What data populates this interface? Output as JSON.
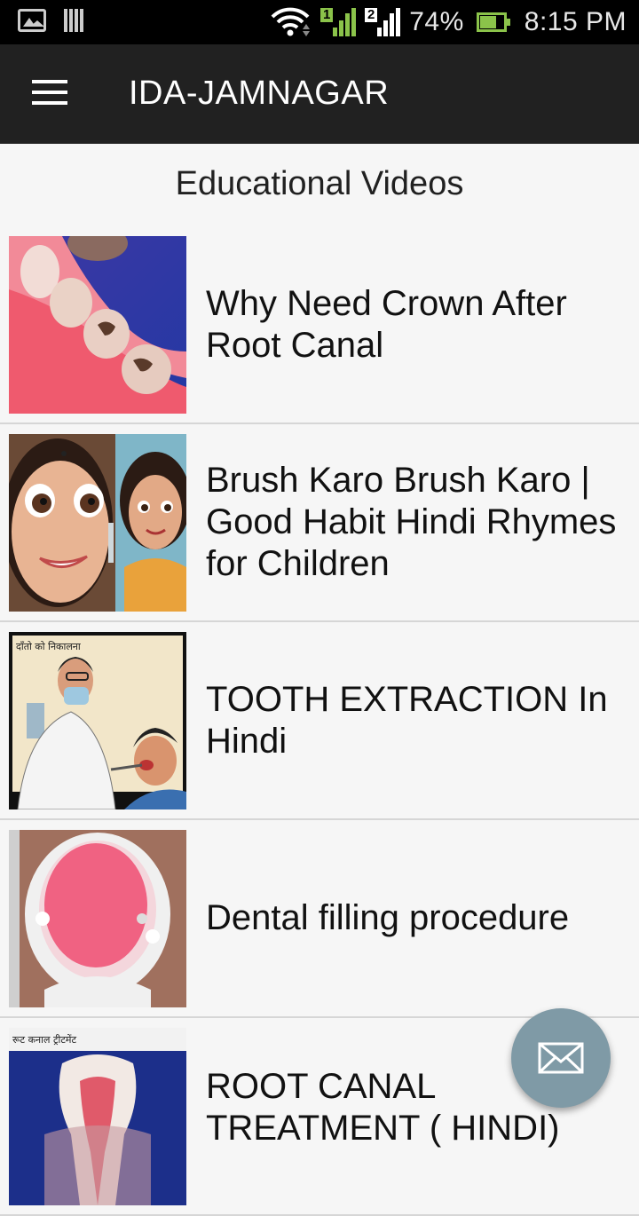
{
  "status_bar": {
    "battery_percent": "74%",
    "battery_level": 0.74,
    "time": "8:15 PM",
    "sim1_label": "1",
    "sim2_label": "2",
    "icons": [
      "gallery-icon",
      "barcode-icon",
      "wifi-icon",
      "signal-icon",
      "battery-charging-icon"
    ]
  },
  "app_bar": {
    "title": "IDA-JAMNAGAR",
    "menu_icon": "hamburger-menu-icon"
  },
  "section": {
    "title": "Educational Videos"
  },
  "videos": [
    {
      "title": "Why Need Crown After Root Canal",
      "thumbnail": "tooth-crown-thumbnail"
    },
    {
      "title": "Brush Karo Brush Karo | Good Habit Hindi Rhymes for Children",
      "thumbnail": "cartoon-children-thumbnail"
    },
    {
      "title": "TOOTH EXTRACTION In Hindi",
      "thumbnail": "dentist-extraction-thumbnail",
      "thumb_caption": "दाँतो को निकालना"
    },
    {
      "title": "Dental filling procedure",
      "thumbnail": "open-mouth-thumbnail"
    },
    {
      "title": "ROOT CANAL TREATMENT ( HINDI)",
      "thumbnail": "root-canal-thumbnail",
      "thumb_caption": "रूट कनाल ट्रीटमेंट"
    }
  ],
  "fab": {
    "icon": "envelope-icon"
  },
  "colors": {
    "status_bar": "#000000",
    "app_bar": "#212121",
    "background": "#f6f6f6",
    "fab": "#7f9aa6",
    "battery": "#8bc34a"
  }
}
